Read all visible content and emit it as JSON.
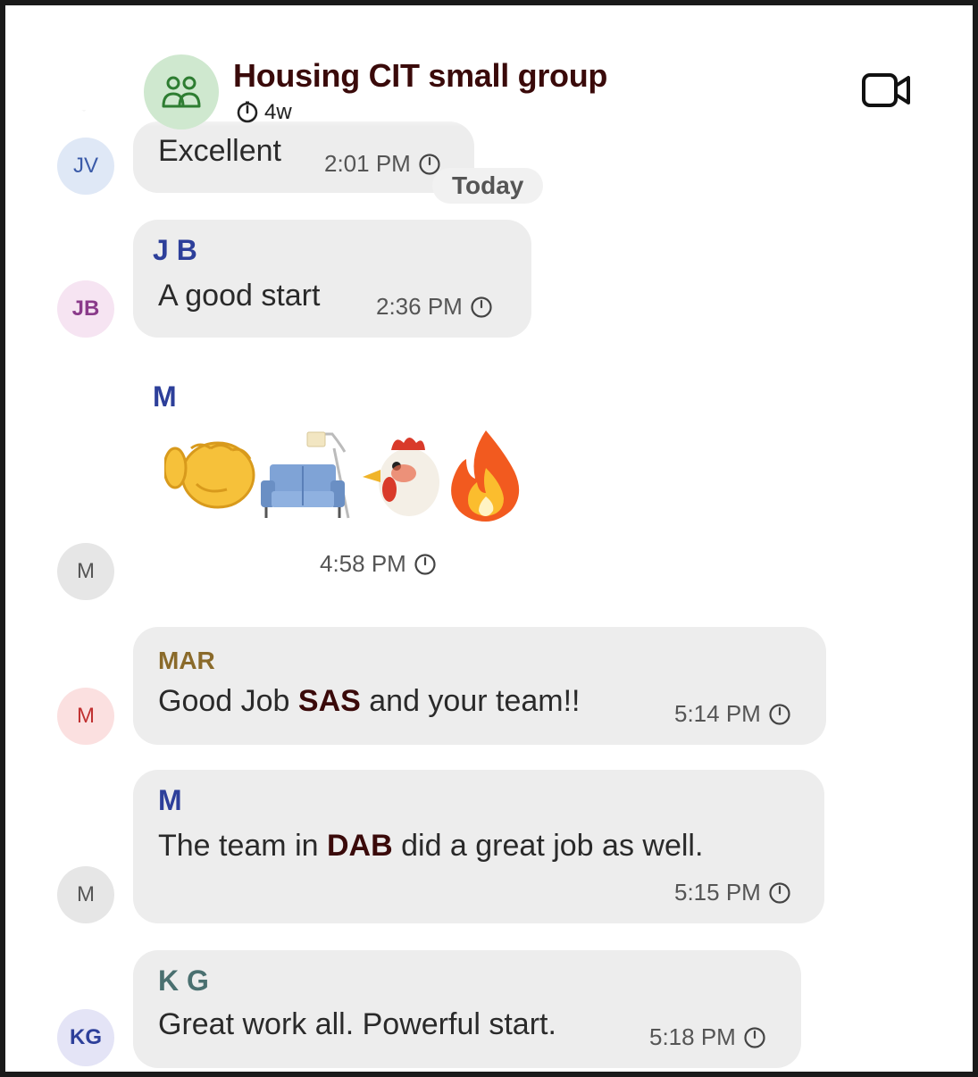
{
  "header": {
    "title": "Housing CIT small group",
    "subtitle": "4w"
  },
  "divider": {
    "label": "Today"
  },
  "messages": [
    {
      "avatar": "JV",
      "text": "Excellent",
      "time": "2:01 PM"
    },
    {
      "avatar": "JB",
      "sender": "J B",
      "text": "A good start",
      "time": "2:36 PM"
    },
    {
      "avatar": "M",
      "sender": "M",
      "emoji": [
        "oncoming-fist",
        "couch-and-lamp",
        "rooster",
        "fire"
      ],
      "time": "4:58 PM"
    },
    {
      "avatar": "M",
      "sender": "MAR",
      "text_pre": "Good Job ",
      "text_bold": "SAS",
      "text_post": " and your team!!",
      "time": "5:14 PM"
    },
    {
      "avatar": "M",
      "sender": "M",
      "text_pre": "The team in ",
      "text_bold": "DAB",
      "text_post": " did a great job  as well.",
      "time": "5:15 PM"
    },
    {
      "avatar": "KG",
      "sender": "K G",
      "text": "Great work all. Powerful start.",
      "time": "5:18 PM"
    }
  ],
  "colors": {
    "sender_blue": "#2d3f9a",
    "sender_gold": "#8a6a2a",
    "sender_teal": "#4a7070",
    "bold_accent": "#3a0a0a"
  }
}
